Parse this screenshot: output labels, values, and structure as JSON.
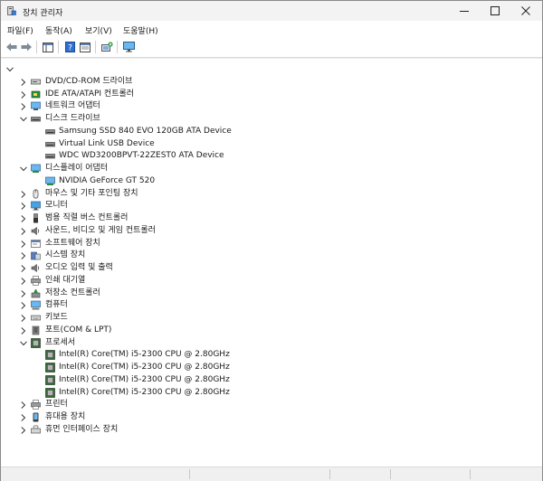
{
  "window": {
    "title": "장치 관리자",
    "controls": {
      "minimize": "minimize-icon",
      "maximize": "maximize-icon",
      "close": "close-icon"
    }
  },
  "menu": [
    {
      "label": "파일(F)"
    },
    {
      "label": "동작(A)"
    },
    {
      "label": "보기(V)"
    },
    {
      "label": "도움말(H)"
    }
  ],
  "toolbar": {
    "buttons": [
      "back-icon",
      "forward-icon",
      "show-hide-tree-icon",
      "properties-icon",
      "help-icon",
      "view-icon",
      "scan-hardware-icon",
      "monitor-icon"
    ]
  },
  "tree": {
    "root_expanded": true,
    "items": [
      {
        "label": "DVD/CD-ROM 드라이브",
        "icon": "dvd-drive-icon",
        "expanded": false
      },
      {
        "label": "IDE ATA/ATAPI 컨트롤러",
        "icon": "ide-controller-icon",
        "expanded": false
      },
      {
        "label": "네트워크 어댑터",
        "icon": "network-adapter-icon",
        "expanded": false
      },
      {
        "label": "디스크 드라이브",
        "icon": "disk-drive-icon",
        "expanded": true,
        "children": [
          {
            "label": "Samsung SSD 840 EVO 120GB ATA Device",
            "icon": "disk-icon"
          },
          {
            "label": "Virtual Link USB Device",
            "icon": "disk-icon"
          },
          {
            "label": "WDC WD3200BPVT-22ZEST0 ATA Device",
            "icon": "disk-icon"
          }
        ]
      },
      {
        "label": "디스플레이 어댑터",
        "icon": "display-adapter-icon",
        "expanded": true,
        "children": [
          {
            "label": "NVIDIA GeForce GT 520",
            "icon": "display-card-icon"
          }
        ]
      },
      {
        "label": "마우스 및 기타 포인팅 장치",
        "icon": "mouse-icon",
        "expanded": false
      },
      {
        "label": "모니터",
        "icon": "monitor-icon",
        "expanded": false
      },
      {
        "label": "범용 직렬 버스 컨트롤러",
        "icon": "usb-icon",
        "expanded": false
      },
      {
        "label": "사운드, 비디오 및 게임 컨트롤러",
        "icon": "sound-icon",
        "expanded": false
      },
      {
        "label": "소프트웨어 장치",
        "icon": "software-device-icon",
        "expanded": false
      },
      {
        "label": "시스템 장치",
        "icon": "system-device-icon",
        "expanded": false
      },
      {
        "label": "오디오 입력 및 출력",
        "icon": "audio-io-icon",
        "expanded": false
      },
      {
        "label": "인쇄 대기열",
        "icon": "print-queue-icon",
        "expanded": false
      },
      {
        "label": "저장소 컨트롤러",
        "icon": "storage-controller-icon",
        "expanded": false
      },
      {
        "label": "컴퓨터",
        "icon": "computer-icon",
        "expanded": false
      },
      {
        "label": "키보드",
        "icon": "keyboard-icon",
        "expanded": false
      },
      {
        "label": "포트(COM & LPT)",
        "icon": "port-icon",
        "expanded": false
      },
      {
        "label": "프로세서",
        "icon": "processor-icon",
        "expanded": true,
        "children": [
          {
            "label": "Intel(R) Core(TM) i5-2300 CPU @ 2.80GHz",
            "icon": "cpu-icon"
          },
          {
            "label": "Intel(R) Core(TM) i5-2300 CPU @ 2.80GHz",
            "icon": "cpu-icon"
          },
          {
            "label": "Intel(R) Core(TM) i5-2300 CPU @ 2.80GHz",
            "icon": "cpu-icon"
          },
          {
            "label": "Intel(R) Core(TM) i5-2300 CPU @ 2.80GHz",
            "icon": "cpu-icon"
          }
        ]
      },
      {
        "label": "프린터",
        "icon": "printer-icon",
        "expanded": false
      },
      {
        "label": "휴대용 장치",
        "icon": "portable-device-icon",
        "expanded": false
      },
      {
        "label": "휴먼 인터페이스 장치",
        "icon": "hid-icon",
        "expanded": false
      }
    ]
  }
}
